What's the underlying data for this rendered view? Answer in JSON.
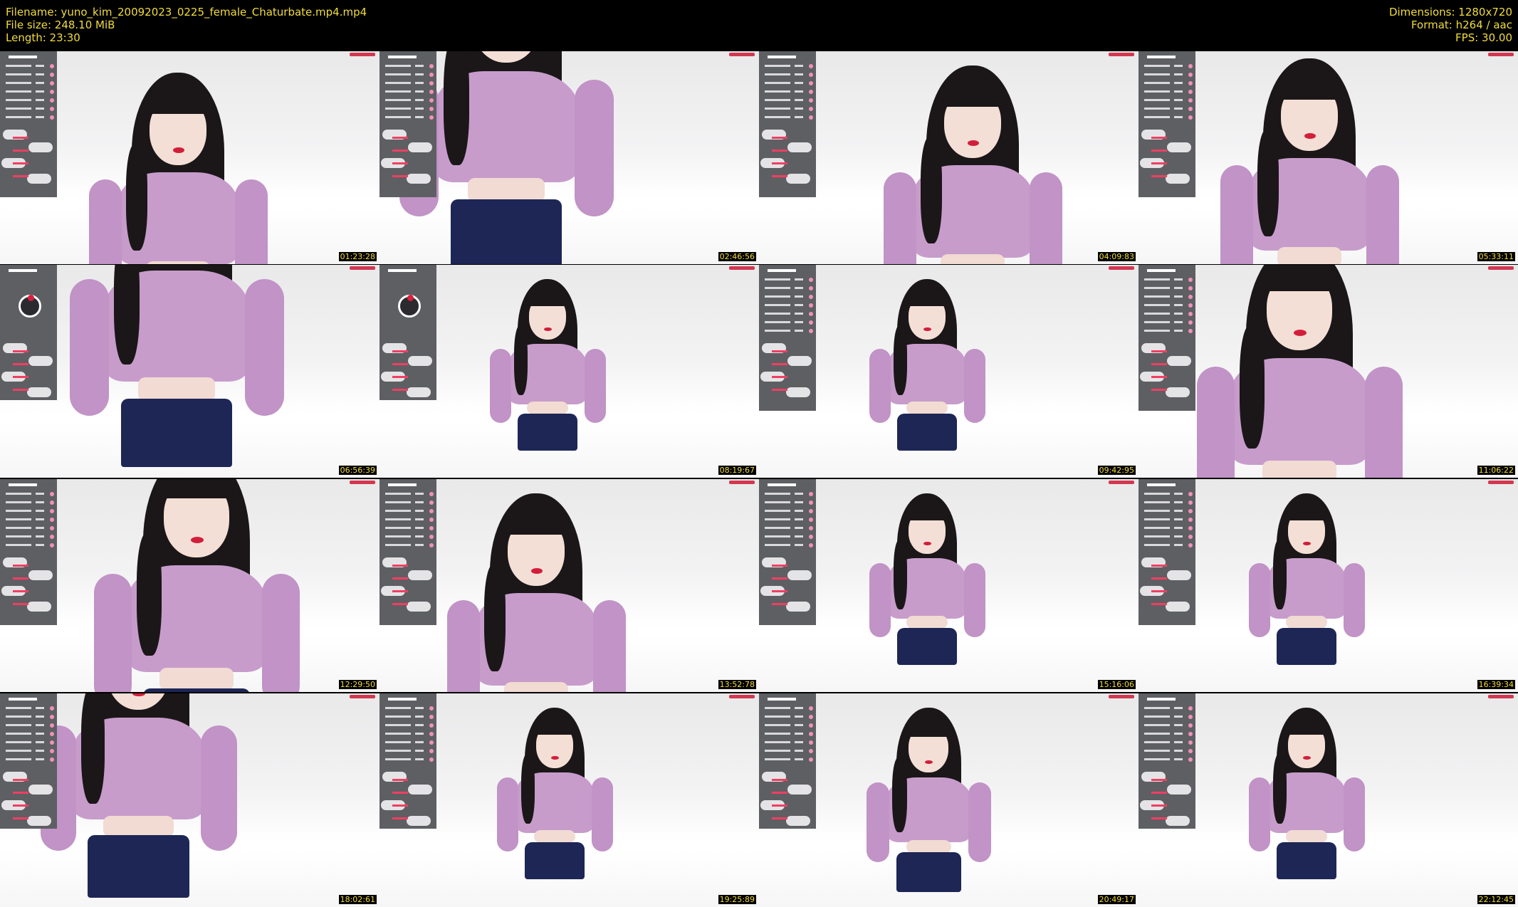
{
  "header": {
    "filename": "Filename: yuno_kim_20092023_0225_female_Chaturbate.mp4.mp4",
    "filesize": "File size: 248.10 MiB",
    "length": "Length: 23:30",
    "dimensions": "Dimensions: 1280x720",
    "format": "Format: h264 / aac",
    "fps": "FPS: 30.00"
  },
  "colors": {
    "header_bg": "#000000",
    "header_text": "#f2dc3c",
    "timestamp_text": "#f2dc3c",
    "timestamp_bg": "#000000"
  },
  "thumbnails": [
    {
      "timestamp": "01:23:28"
    },
    {
      "timestamp": "02:46:56"
    },
    {
      "timestamp": "04:09:83"
    },
    {
      "timestamp": "05:33:11"
    },
    {
      "timestamp": "06:56:39"
    },
    {
      "timestamp": "08:19:67"
    },
    {
      "timestamp": "09:42:95"
    },
    {
      "timestamp": "11:06:22"
    },
    {
      "timestamp": "12:29:50"
    },
    {
      "timestamp": "13:52:78"
    },
    {
      "timestamp": "15:16:06"
    },
    {
      "timestamp": "16:39:34"
    },
    {
      "timestamp": "18:02:61"
    },
    {
      "timestamp": "19:25:89"
    },
    {
      "timestamp": "20:49:17"
    },
    {
      "timestamp": "22:12:45"
    }
  ]
}
